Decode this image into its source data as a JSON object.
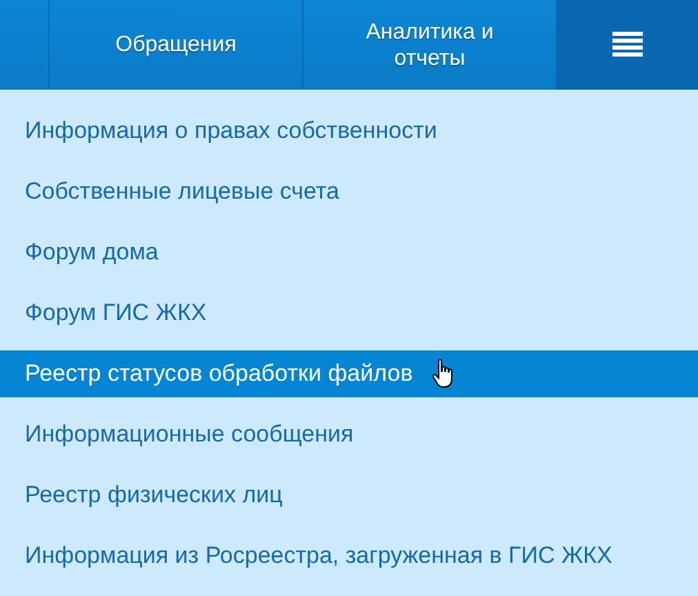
{
  "nav": {
    "tabs": [
      {
        "label": "Обращения"
      },
      {
        "label": "Аналитика и отчеты"
      }
    ],
    "menu_button": {
      "expanded": true
    }
  },
  "menu": {
    "items": [
      {
        "label": "Информация о правах собственности",
        "selected": false
      },
      {
        "label": "Собственные лицевые счета",
        "selected": false
      },
      {
        "label": "Форум дома",
        "selected": false
      },
      {
        "label": "Форум ГИС ЖКХ",
        "selected": false
      },
      {
        "label": "Реестр статусов обработки файлов",
        "selected": true
      },
      {
        "label": "Информационные сообщения",
        "selected": false
      },
      {
        "label": "Реестр физических лиц",
        "selected": false
      },
      {
        "label": "Информация из Росреестра, загруженная в ГИС ЖКХ",
        "selected": false
      }
    ]
  }
}
